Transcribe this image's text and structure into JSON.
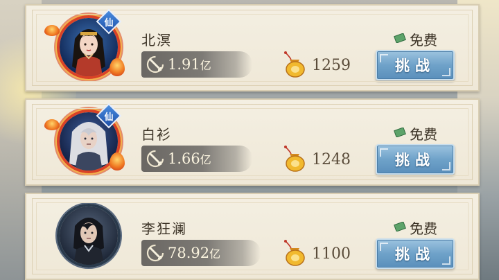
{
  "colors": {
    "card_bg": "#f4efe2",
    "button_blue": "#6fa2c9",
    "avatar_frame_red": "#d94226",
    "power_bar": "#7d7a75"
  },
  "entries": [
    {
      "name": "北溟",
      "power": "1.91",
      "power_unit": "亿",
      "score": "1259",
      "badge": "仙",
      "free_label": "免费",
      "challenge_label": "挑战"
    },
    {
      "name": "白衫",
      "power": "1.66",
      "power_unit": "亿",
      "score": "1248",
      "badge": "仙",
      "free_label": "免费",
      "challenge_label": "挑战"
    },
    {
      "name": "李狂澜",
      "power": "78.92",
      "power_unit": "亿",
      "score": "1100",
      "free_label": "免费",
      "challenge_label": "挑战"
    }
  ],
  "icons": {
    "power": "crossed-sword-icon",
    "score": "gold-purse-icon",
    "free": "jade-ticket-icon"
  }
}
